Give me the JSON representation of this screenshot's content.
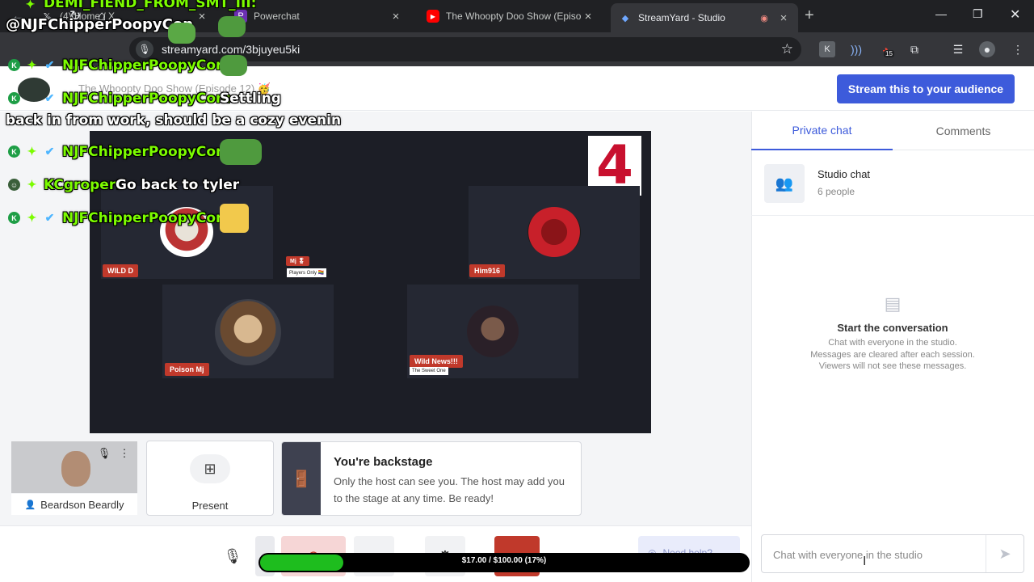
{
  "browser": {
    "tabs": [
      {
        "title": "(4) Home / X",
        "favicon": "x-icon"
      },
      {
        "title": "Powerchat",
        "favicon": "powerchat-icon"
      },
      {
        "title": "The Whoopty Doo Show (Episo",
        "favicon": "youtube-icon"
      },
      {
        "title": "StreamYard - Studio",
        "favicon": "streamyard-icon",
        "active": true
      }
    ],
    "url": "streamyard.com/3bjuyeu5ki",
    "extension_badge": "15"
  },
  "studio": {
    "show_title": "The Whoopty Doo Show (Episode 12) 🥳",
    "stream_button": "Stream this to your audience",
    "logo": "4",
    "participants": [
      {
        "name": "WILD D"
      },
      {
        "name": "Mj 🎖",
        "subtitle": "Players Only 🏳️‍🌈"
      },
      {
        "name": "Him916"
      },
      {
        "name": "Poison Mj"
      },
      {
        "name": "Wild News!!!",
        "subtitle": "The Sweet One"
      }
    ],
    "backstage_self": {
      "name": "Beardson Beardly"
    },
    "present_label": "Present",
    "backstage_notice": {
      "heading": "You're backstage",
      "text": "Only the host can see you. The host may add you to the stage at any time. Be ready!"
    },
    "need_help": "Need help?"
  },
  "chat": {
    "tabs": [
      "Private chat",
      "Comments"
    ],
    "studio_chat": {
      "title": "Studio chat",
      "subtitle": "6 people"
    },
    "empty_heading": "Start the conversation",
    "empty_lines": [
      "Chat with everyone in the studio.",
      "Messages are cleared after each session.",
      "Viewers will not see these messages."
    ],
    "input_placeholder": "Chat with everyone in the studio"
  },
  "overlay": {
    "top_user": "DEMI_FIEND_FROM_SMT_III:",
    "top_mention": "@NJFChipperPoopyCon",
    "messages": [
      {
        "user": "NJFChipperPoopyCon:",
        "text": ""
      },
      {
        "user": "NJFChipperPoopyCon:",
        "text": "Settling"
      },
      {
        "user": "",
        "text": "back in from work, should be a cozy evenin"
      },
      {
        "user": "NJFChipperPoopyCon:",
        "text": ""
      },
      {
        "user": "KCgroper:",
        "text": "Go back to tyler"
      },
      {
        "user": "NJFChipperPoopyCon:",
        "text": ""
      }
    ],
    "donation": {
      "label": "$17.00 / $100.00 (17%)",
      "progress": 0.17
    }
  },
  "colors": {
    "accent": "#3d5bdb",
    "stage_bg": "#1c1e26",
    "nametag": "#c0392b",
    "overlay_user": "#7cfc00",
    "donation_fill": "#1ebd1e"
  }
}
